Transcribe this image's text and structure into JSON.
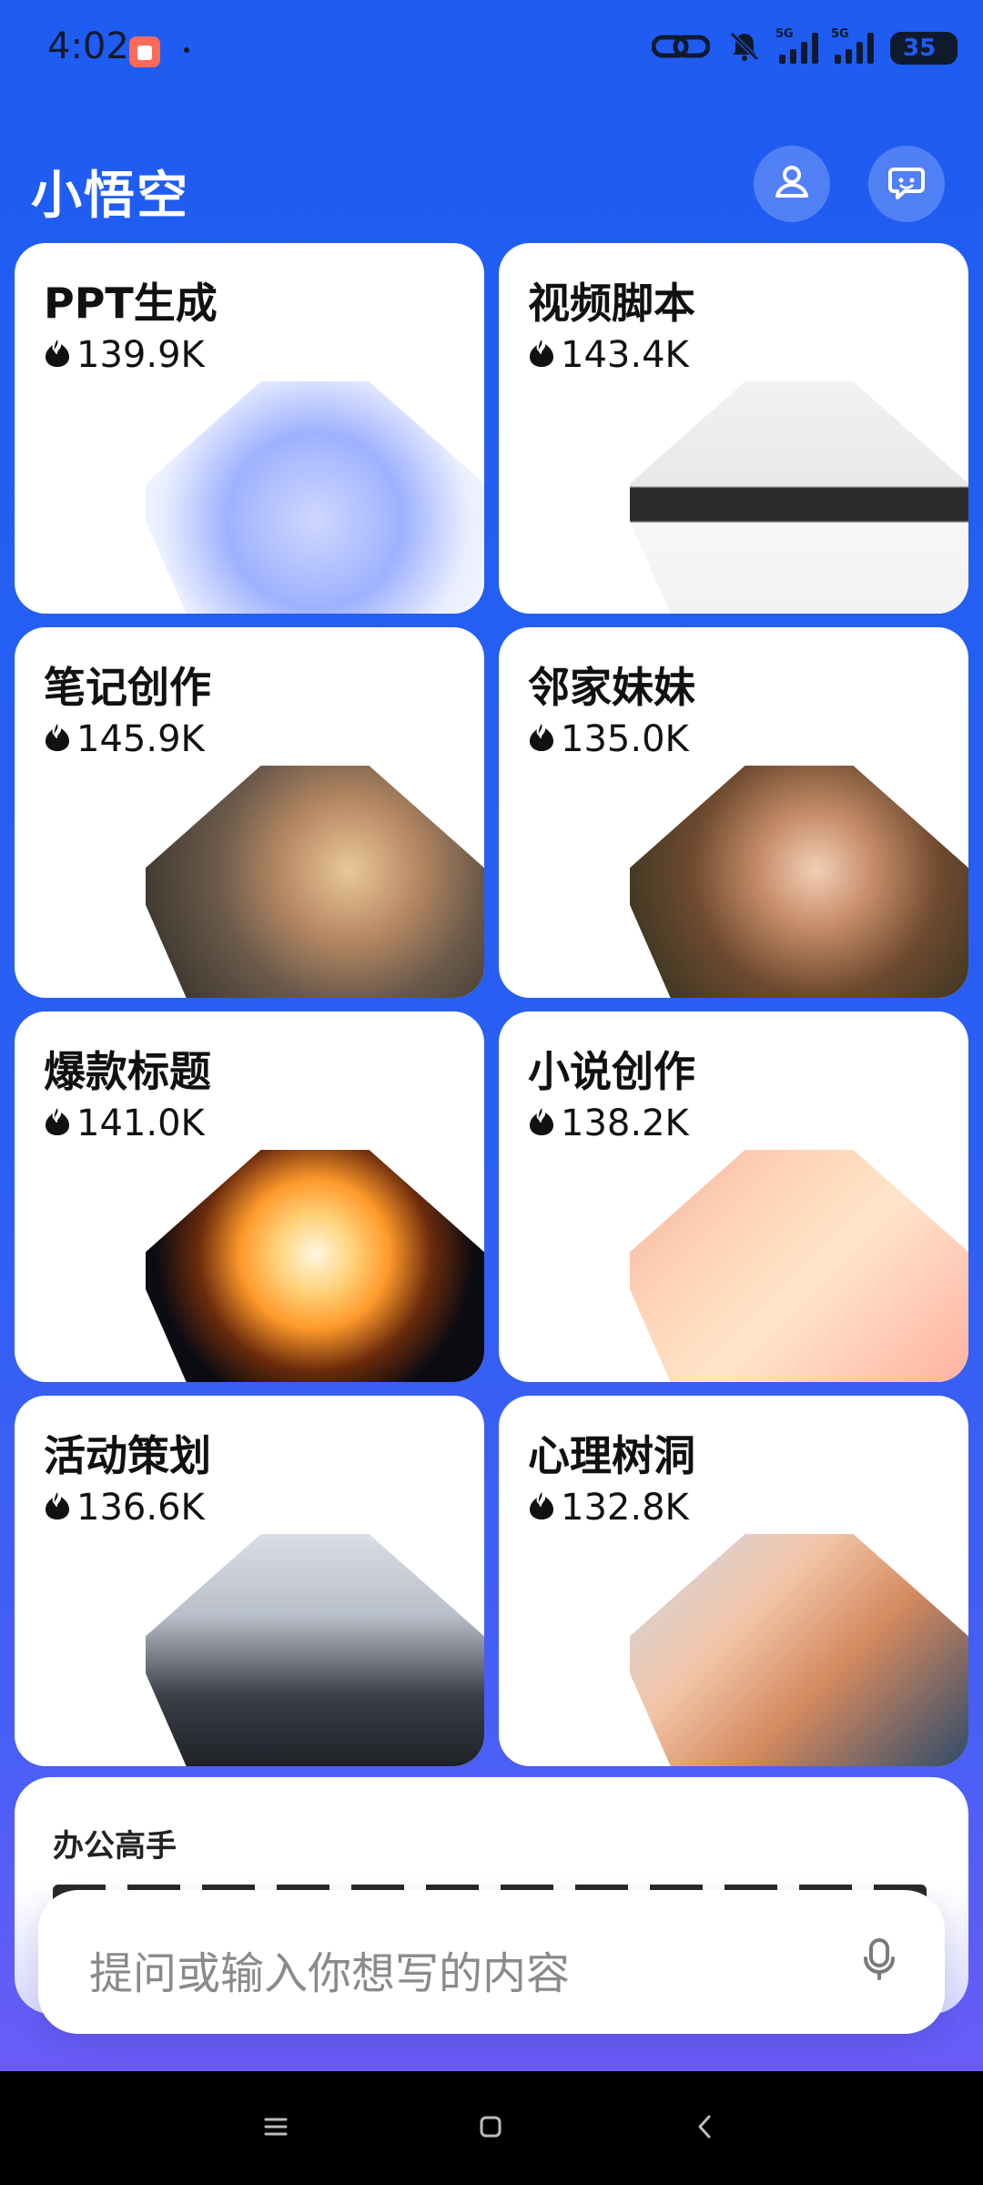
{
  "status": {
    "time": "4:02",
    "network_label": "5G",
    "battery": "35"
  },
  "header": {
    "title": "小悟空"
  },
  "cards": [
    {
      "title": "PPT生成",
      "count": "139.9K",
      "image": "3d-presentation-illustration"
    },
    {
      "title": "视频脚本",
      "count": "143.4K",
      "image": "film-clapperboard-photo"
    },
    {
      "title": "笔记创作",
      "count": "145.9K",
      "image": "woman-portrait-cafe"
    },
    {
      "title": "邻家妹妹",
      "count": "135.0K",
      "image": "laughing-girl-portrait"
    },
    {
      "title": "爆款标题",
      "count": "141.0K",
      "image": "fire-explosion-photo"
    },
    {
      "title": "小说创作",
      "count": "138.2K",
      "image": "pen-writing-letter"
    },
    {
      "title": "活动策划",
      "count": "136.6K",
      "image": "event-crowd-photo"
    },
    {
      "title": "心理树洞",
      "count": "132.8K",
      "image": "holding-hands-photo"
    }
  ],
  "office": {
    "title": "办公高手"
  },
  "input": {
    "placeholder": "提问或输入你想写的内容"
  },
  "colors": {
    "accent": "#1e5cf2",
    "card_bg": "#ffffff",
    "text_primary": "#111111",
    "placeholder": "#8a8a8a"
  }
}
